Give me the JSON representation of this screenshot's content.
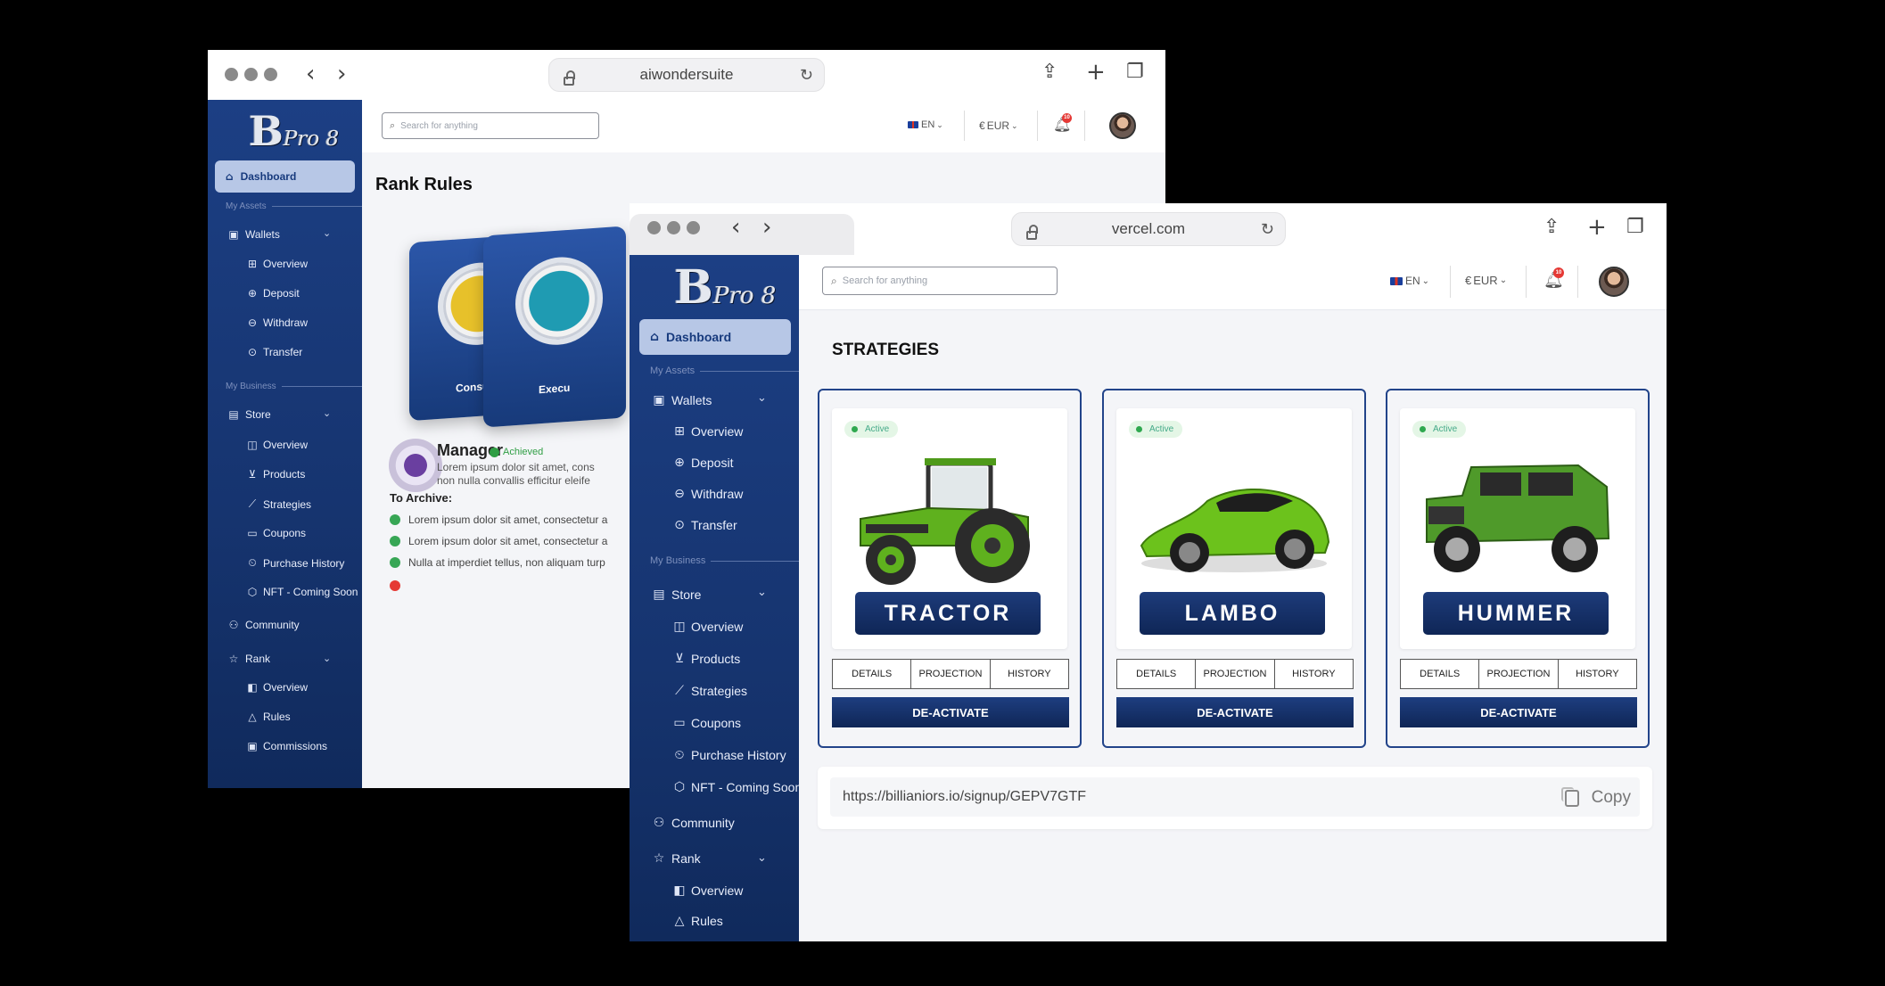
{
  "window1": {
    "url": "aiwondersuite",
    "logo": {
      "main": "B",
      "sub": "Pro 8"
    },
    "sidebar": {
      "dashboard": "Dashboard",
      "section_assets": "My Assets",
      "wallets": "Wallets",
      "wallet_items": [
        "Overview",
        "Deposit",
        "Withdraw",
        "Transfer"
      ],
      "section_business": "My Business",
      "store": "Store",
      "store_items": [
        "Overview",
        "Products",
        "Strategies",
        "Coupons",
        "Purchase History",
        "NFT - Coming Soon"
      ],
      "community": "Community",
      "rank": "Rank",
      "rank_items": [
        "Overview",
        "Rules",
        "Commissions"
      ]
    },
    "topbar": {
      "search_placeholder": "Search for anything",
      "lang": "EN",
      "currency": "EUR",
      "notifications": "10"
    },
    "page_title": "Rank Rules",
    "rank_cards": [
      {
        "label": "Consult"
      },
      {
        "label": "Execu"
      }
    ],
    "current_rank": {
      "name": "Manager",
      "status": "Achieved",
      "desc_line1": "Lorem ipsum dolor sit amet, cons",
      "desc_line2": "non nulla convallis efficitur eleife"
    },
    "archive": {
      "title": "To Archive:",
      "items": [
        "Lorem ipsum dolor sit amet, consectetur a",
        "Lorem ipsum dolor sit amet, consectetur a",
        "Nulla at imperdiet tellus, non aliquam turp"
      ]
    }
  },
  "window2": {
    "url": "vercel.com",
    "logo": {
      "main": "B",
      "sub": "Pro 8"
    },
    "sidebar": {
      "dashboard": "Dashboard",
      "section_assets": "My Assets",
      "wallets": "Wallets",
      "wallet_items": [
        "Overview",
        "Deposit",
        "Withdraw",
        "Transfer"
      ],
      "section_business": "My Business",
      "store": "Store",
      "store_items": [
        "Overview",
        "Products",
        "Strategies",
        "Coupons",
        "Purchase History",
        "NFT - Coming Soon"
      ],
      "community": "Community",
      "rank": "Rank",
      "rank_items": [
        "Overview",
        "Rules"
      ]
    },
    "topbar": {
      "search_placeholder": "Search for anything",
      "lang": "EN",
      "currency": "EUR",
      "notifications": "10"
    },
    "page_title": "STRATEGIES",
    "strategies": [
      {
        "name": "TRACTOR",
        "status": "Active",
        "tabs": [
          "DETAILS",
          "PROJECTION",
          "HISTORY"
        ],
        "action": "DE-ACTIVATE",
        "color": "#5fb11e"
      },
      {
        "name": "LAMBO",
        "status": "Active",
        "tabs": [
          "DETAILS",
          "PROJECTION",
          "HISTORY"
        ],
        "action": "DE-ACTIVATE",
        "color": "#6cc21c"
      },
      {
        "name": "HUMMER",
        "status": "Active",
        "tabs": [
          "DETAILS",
          "PROJECTION",
          "HISTORY"
        ],
        "action": "DE-ACTIVATE",
        "color": "#4f9a2a"
      }
    ],
    "referral": {
      "url": "https://billianiors.io/signup/GEPV7GTF",
      "copy_label": "Copy"
    }
  },
  "colors": {
    "sidebar": "#1c3f84",
    "accent": "#0f2656",
    "active_green": "#2fa84f"
  }
}
